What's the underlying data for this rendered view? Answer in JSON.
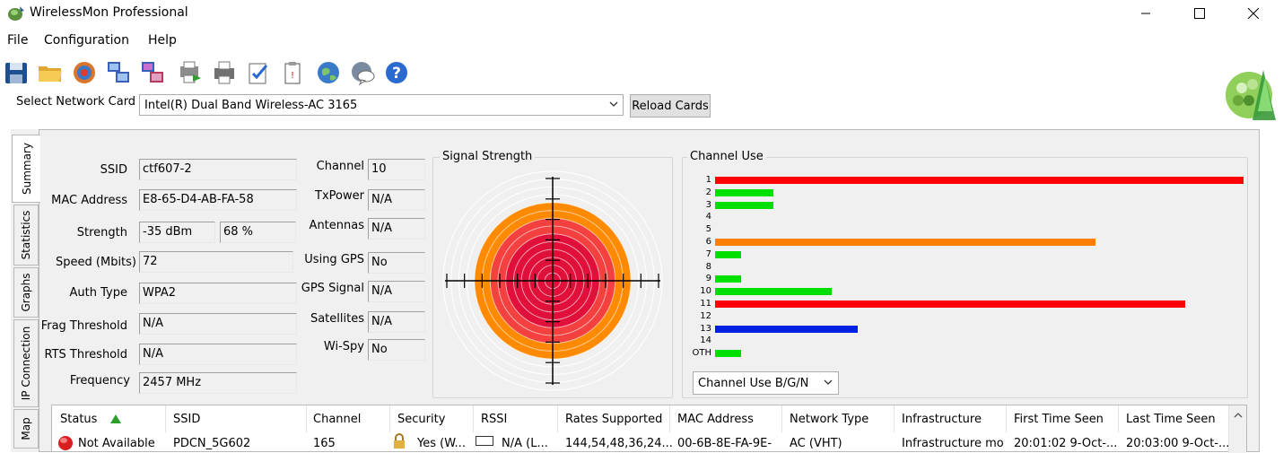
{
  "window": {
    "title": "WirelessMon Professional"
  },
  "menu": [
    "File",
    "Configuration",
    "Help"
  ],
  "toolbar": {
    "icons": [
      "save-icon",
      "open-folder-icon",
      "target-icon",
      "network-card-icon",
      "network-card-log-icon",
      "print-preview-icon",
      "print-icon",
      "settings-check-icon",
      "clipboard-icon",
      "web-icon",
      "web-support-icon",
      "help-icon"
    ]
  },
  "network_card": {
    "label": "Select Network Card",
    "value": "Intel(R) Dual Band Wireless-AC 3165",
    "reload_label": "Reload Cards"
  },
  "tabs": [
    "Summary",
    "Statistics",
    "Graphs",
    "IP Connection",
    "Map"
  ],
  "summary": {
    "ssid_label": "SSID",
    "ssid": "ctf607-2",
    "mac_label": "MAC Address",
    "mac": "E8-65-D4-AB-FA-58",
    "strength_label": "Strength",
    "strength_dbm": "-35 dBm",
    "strength_pct": "68 %",
    "speed_label": "Speed (Mbits)",
    "speed": "72",
    "auth_label": "Auth Type",
    "auth": "WPA2",
    "frag_label": "Frag Threshold",
    "frag": "N/A",
    "rts_label": "RTS Threshold",
    "rts": "N/A",
    "freq_label": "Frequency",
    "freq": "2457 MHz",
    "channel_label": "Channel",
    "channel": "10",
    "txpower_label": "TxPower",
    "txpower": "N/A",
    "antennas_label": "Antennas",
    "antennas": "N/A",
    "gps_label": "Using GPS",
    "gps": "No",
    "gps_signal_label": "GPS Signal",
    "gps_signal": "N/A",
    "satellites_label": "Satellites",
    "satellites": "N/A",
    "wispy_label": "Wi-Spy",
    "wispy": "No"
  },
  "signal": {
    "title": "Signal Strength",
    "level_pct": 68
  },
  "channel_use": {
    "title": "Channel Use",
    "mode": "Channel Use B/G/N",
    "colors": {
      "red": "#ff0000",
      "green": "#00e000",
      "orange": "#ff8000",
      "blue": "#0020e0"
    }
  },
  "chart_data": {
    "type": "bar",
    "orientation": "horizontal",
    "title": "Channel Use",
    "categories": [
      "1",
      "2",
      "3",
      "4",
      "5",
      "6",
      "7",
      "8",
      "9",
      "10",
      "11",
      "12",
      "13",
      "14",
      "OTH"
    ],
    "values": [
      100,
      11,
      11,
      0,
      0,
      72,
      5,
      0,
      5,
      22,
      89,
      0,
      27,
      0,
      5
    ],
    "bar_colors": [
      "red",
      "green",
      "green",
      "none",
      "none",
      "orange",
      "green",
      "none",
      "green",
      "green",
      "red",
      "none",
      "blue",
      "none",
      "green"
    ]
  },
  "table": {
    "columns": [
      "Status",
      "SSID",
      "Channel",
      "Security",
      "RSSI",
      "Rates Supported",
      "MAC Address",
      "Network Type",
      "Infrastructure",
      "First Time Seen",
      "Last Time Seen"
    ],
    "rows": [
      [
        "Not Available",
        "PDCN_5G602",
        "165",
        "Yes (W...",
        "N/A (L...",
        "144,54,48,36,24...",
        "00-6B-8E-FA-9E-",
        "AC (VHT)",
        "Infrastructure mo",
        "20:01:02 9-Oct-...",
        "20:03:00 9-Oct-..."
      ]
    ]
  }
}
